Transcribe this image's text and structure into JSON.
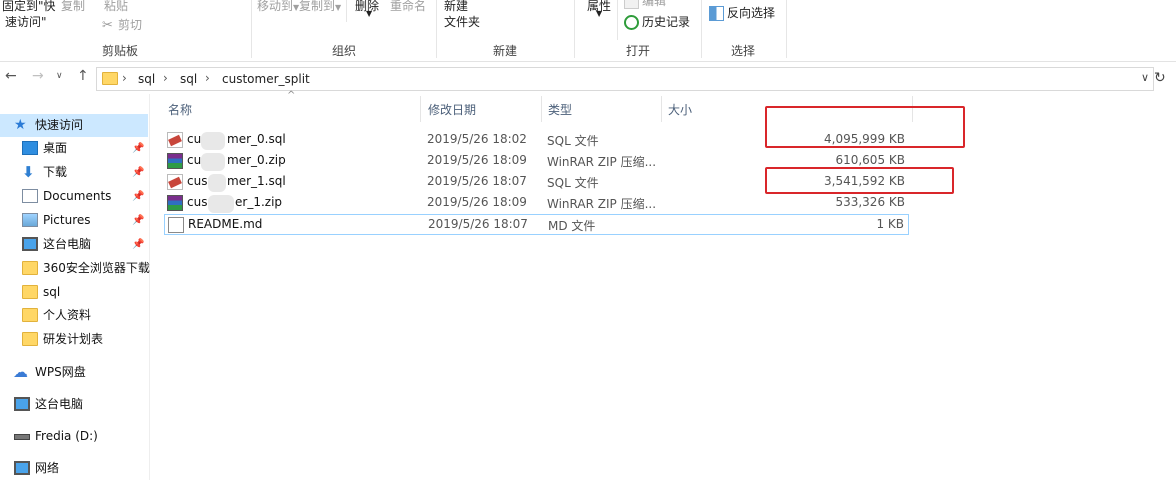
{
  "ribbon": {
    "pin_quick_access_line1": "固定到\"快",
    "pin_quick_access_line2": "速访问\"",
    "copy": "复制",
    "paste": "粘贴",
    "cut": "剪切",
    "move_to": "移动到",
    "copy_to": "复制到",
    "delete": "删除",
    "rename": "重命名",
    "new_folder_line1": "新建",
    "new_folder_line2": "文件夹",
    "properties": "属性",
    "edit": "编辑",
    "history": "历史记录",
    "invert_selection": "反向选择",
    "groups": {
      "clipboard": "剪贴板",
      "organize": "组织",
      "new": "新建",
      "open": "打开",
      "select": "选择"
    }
  },
  "address_bar": {
    "path": [
      "sql",
      "sql",
      "customer_split"
    ]
  },
  "nav_pane": {
    "quick_access": "快速访问",
    "items": [
      {
        "label": "桌面",
        "icon": "desktop-icon",
        "pinned": true
      },
      {
        "label": "下载",
        "icon": "download-icon",
        "pinned": true
      },
      {
        "label": "Documents",
        "icon": "documents-icon",
        "pinned": true
      },
      {
        "label": "Pictures",
        "icon": "pictures-icon",
        "pinned": true
      },
      {
        "label": "这台电脑",
        "icon": "computer-icon",
        "pinned": true
      },
      {
        "label": "360安全浏览器下载",
        "icon": "folder-icon",
        "pinned": false
      },
      {
        "label": "sql",
        "icon": "folder-icon",
        "pinned": false
      },
      {
        "label": "个人资料",
        "icon": "folder-icon",
        "pinned": false
      },
      {
        "label": "研发计划表",
        "icon": "folder-icon",
        "pinned": false
      }
    ],
    "wps": "WPS网盘",
    "this_pc": "这台电脑",
    "drive": "Fredia (D:)",
    "network": "网络"
  },
  "file_list": {
    "columns": {
      "name": "名称",
      "date": "修改日期",
      "type": "类型",
      "size": "大小"
    },
    "rows": [
      {
        "name_prefix": "cu",
        "name_suffix": "mer_0.sql",
        "date": "2019/5/26 18:02",
        "type": "SQL 文件",
        "size": "4,095,999 KB",
        "icon": "sql-file-icon"
      },
      {
        "name_prefix": "cu",
        "name_suffix": "mer_0.zip",
        "date": "2019/5/26 18:09",
        "type": "WinRAR ZIP 压缩...",
        "size": "610,605 KB",
        "icon": "zip-archive-icon"
      },
      {
        "name_prefix": "cus",
        "name_suffix": "mer_1.sql",
        "date": "2019/5/26 18:07",
        "type": "SQL 文件",
        "size": "3,541,592 KB",
        "icon": "sql-file-icon"
      },
      {
        "name_prefix": "cus",
        "name_suffix": "er_1.zip",
        "date": "2019/5/26 18:09",
        "type": "WinRAR ZIP 压缩...",
        "size": "533,326 KB",
        "icon": "zip-archive-icon"
      },
      {
        "name_prefix": "",
        "name_suffix": "README.md",
        "date": "2019/5/26 18:07",
        "type": "MD 文件",
        "size": "1 KB",
        "icon": "markdown-file-icon"
      }
    ]
  },
  "colors": {
    "selection": "#cce8ff",
    "highlight_box": "#d9262a",
    "header_text": "#4c607a"
  }
}
